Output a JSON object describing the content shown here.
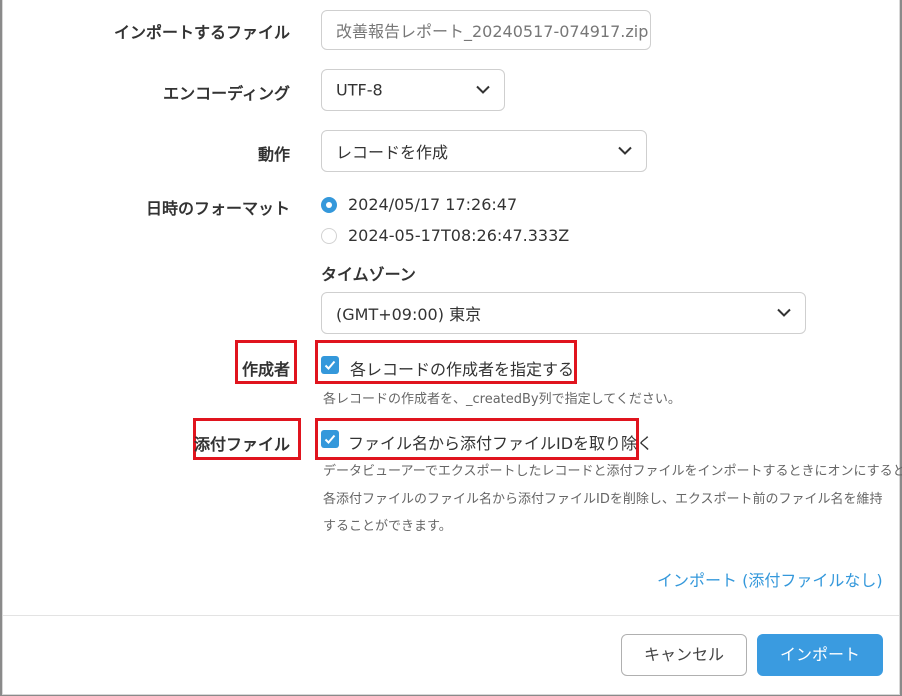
{
  "form": {
    "file": {
      "label": "インポートするファイル",
      "value": "改善報告レポート_20240517-074917.zip"
    },
    "encoding": {
      "label": "エンコーディング",
      "value": "UTF-8"
    },
    "action": {
      "label": "動作",
      "value": "レコードを作成"
    },
    "datetime_format": {
      "label": "日時のフォーマット",
      "options": [
        {
          "label": "2024/05/17 17:26:47",
          "selected": true
        },
        {
          "label": "2024-05-17T08:26:47.333Z",
          "selected": false
        }
      ],
      "timezone_label": "タイムゾーン",
      "timezone_value": "(GMT+09:00) 東京"
    },
    "creator": {
      "label": "作成者",
      "checkbox_label": "各レコードの作成者を指定する",
      "checked": true,
      "help": "各レコードの作成者を、_createdBy列で指定してください。"
    },
    "attachments": {
      "label": "添付ファイル",
      "checkbox_label": "ファイル名から添付ファイルIDを取り除く",
      "checked": true,
      "help_lines": [
        "データビューアーでエクスポートしたレコードと添付ファイルをインポートするときにオンにすると、",
        "各添付ファイルのファイル名から添付ファイルIDを削除し、エクスポート前のファイル名を維持",
        "することができます。"
      ]
    },
    "import_without_attachments": "インポート (添付ファイルなし)"
  },
  "footer": {
    "cancel_label": "キャンセル",
    "import_label": "インポート"
  },
  "colors": {
    "accent": "#3498db",
    "highlight_box": "#e0141e"
  }
}
